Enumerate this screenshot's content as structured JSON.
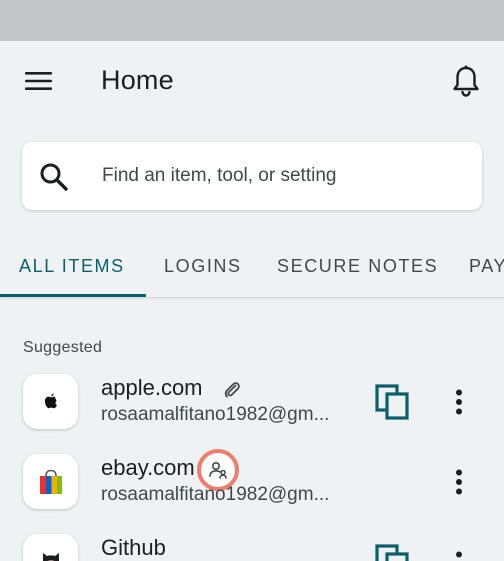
{
  "header": {
    "title": "Home",
    "menu_icon": "hamburger-menu-icon",
    "notification_icon": "bell-icon"
  },
  "search": {
    "placeholder": "Find an item, tool, or setting",
    "value": ""
  },
  "tabs": [
    {
      "label": "ALL ITEMS",
      "active": true
    },
    {
      "label": "LOGINS",
      "active": false
    },
    {
      "label": "SECURE NOTES",
      "active": false
    },
    {
      "label": "PAY",
      "active": false
    }
  ],
  "suggested": {
    "label": "Suggested",
    "items": [
      {
        "title": "apple.com",
        "subtitle": "rosaamalfitano1982@gm...",
        "badge": "paperclip-icon",
        "logo": "apple-logo-icon"
      },
      {
        "title": "ebay.com",
        "subtitle": "rosaamalfitano1982@gm...",
        "badge": "shared-user-icon",
        "logo": "ebay-bag-logo-icon"
      },
      {
        "title": "Github",
        "subtitle": "",
        "badge": "",
        "logo": "github-octocat-logo-icon"
      }
    ]
  },
  "colors": {
    "accent": "#0a5f6a",
    "background": "#eef2f3",
    "status_bar": "#c3c7c9",
    "highlight": "#f07d6b"
  }
}
